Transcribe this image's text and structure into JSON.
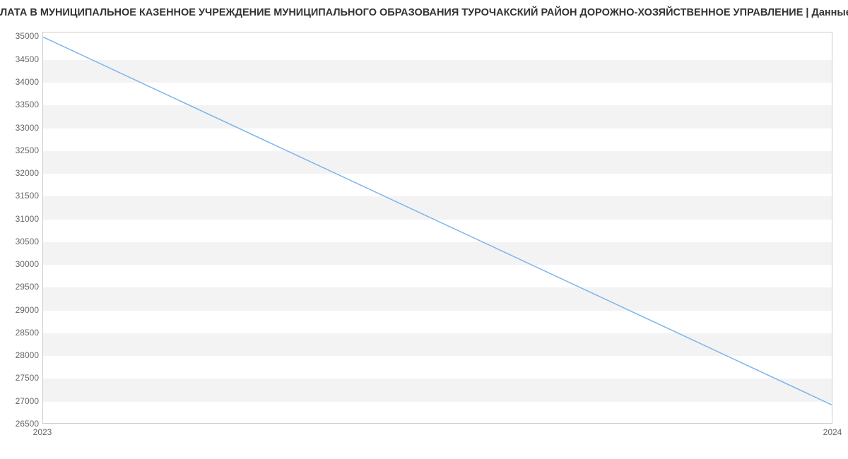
{
  "title": "ЛАТА В МУНИЦИПАЛЬНОЕ КАЗЕННОЕ УЧРЕЖДЕНИЕ МУНИЦИПАЛЬНОГО ОБРАЗОВАНИЯ ТУРОЧАКСКИЙ РАЙОН ДОРОЖНО-ХОЗЯЙСТВЕННОЕ УПРАВЛЕНИЕ | Данные mnogo.",
  "chart_data": {
    "type": "line",
    "x": [
      2023,
      2024
    ],
    "y": [
      35000,
      26900
    ],
    "y_ticks": [
      26500,
      27000,
      27500,
      28000,
      28500,
      29000,
      29500,
      30000,
      30500,
      31000,
      31500,
      32000,
      32500,
      33000,
      33500,
      34000,
      34500,
      35000
    ],
    "x_ticks": [
      2023,
      2024
    ],
    "ylim": [
      26500,
      35100
    ],
    "xlabel": "",
    "ylabel": "",
    "title": "ЛАТА В МУНИЦИПАЛЬНОЕ КАЗЕННОЕ УЧРЕЖДЕНИЕ МУНИЦИПАЛЬНОГО ОБРАЗОВАНИЯ ТУРОЧАКСКИЙ РАЙОН ДОРОЖНО-ХОЗЯЙСТВЕННОЕ УПРАВЛЕНИЕ | Данные mnogo."
  }
}
